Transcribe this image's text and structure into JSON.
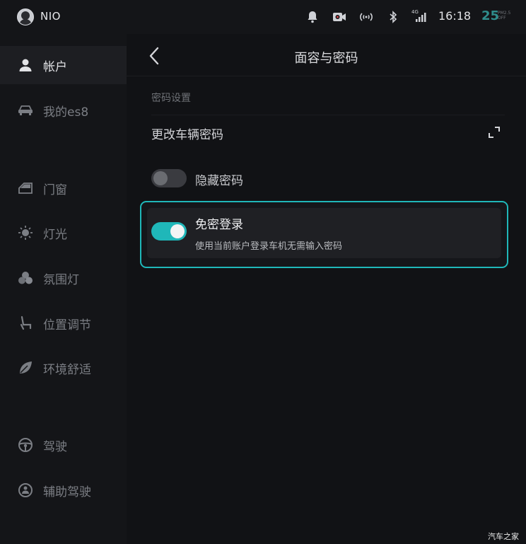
{
  "status_bar": {
    "brand": "NIO",
    "time": "16:18",
    "pm_value": "25",
    "pm_label_1": "PM2.5",
    "pm_label_2": "OFF",
    "network_label": "4G",
    "icons": [
      "bell-icon",
      "camera-record-icon",
      "wireless-signal-icon",
      "bluetooth-icon",
      "cellular-signal-icon"
    ]
  },
  "sidebar": {
    "items": [
      {
        "label": "帐户",
        "icon": "user-icon",
        "active": true
      },
      {
        "label": "我的es8",
        "icon": "car-icon",
        "active": false
      },
      {
        "label": "门窗",
        "icon": "door-icon",
        "active": false
      },
      {
        "label": "灯光",
        "icon": "light-icon",
        "active": false
      },
      {
        "label": "氛围灯",
        "icon": "ambient-light-icon",
        "active": false
      },
      {
        "label": "位置调节",
        "icon": "seat-icon",
        "active": false
      },
      {
        "label": "环境舒适",
        "icon": "leaf-icon",
        "active": false
      },
      {
        "label": "驾驶",
        "icon": "steering-wheel-icon",
        "active": false
      },
      {
        "label": "辅助驾驶",
        "icon": "assist-driving-icon",
        "active": false
      }
    ]
  },
  "main": {
    "title": "面容与密码",
    "section_label": "密码设置",
    "change_password": "更改车辆密码",
    "hide_password": {
      "label": "隐藏密码",
      "enabled": false
    },
    "password_free": {
      "title": "免密登录",
      "description": "使用当前账户登录车机无需输入密码",
      "enabled": true
    }
  },
  "colors": {
    "accent": "#1fb7b9",
    "background": "#111215",
    "sidebar": "#141518"
  },
  "watermark": "汽车之家"
}
